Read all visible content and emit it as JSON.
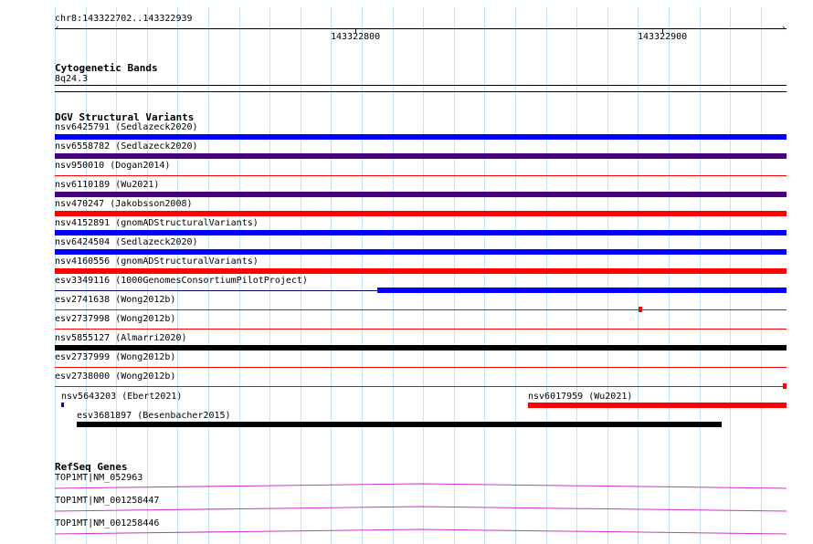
{
  "ruler": {
    "location": "chr8:143322702..143322939",
    "ticks": [
      "143322800",
      "143322900"
    ]
  },
  "cytoband": {
    "title": "Cytogenetic Bands",
    "band": "8q24.3"
  },
  "dgv": {
    "title": "DGV Structural Variants",
    "rows": [
      {
        "label": "nsv6425791 (Sedlazeck2020)",
        "color": "#0000ff",
        "type": "bar"
      },
      {
        "label": "nsv6558782 (Sedlazeck2020)",
        "color": "#4b0082",
        "type": "bar"
      },
      {
        "label": "nsv950010 (Dogan2014)",
        "color": "#ff0000",
        "type": "line"
      },
      {
        "label": "nsv6110189 (Wu2021)",
        "color": "#4b0082",
        "type": "bar"
      },
      {
        "label": "nsv470247 (Jakobsson2008)",
        "color": "#ff0000",
        "type": "bar"
      },
      {
        "label": "nsv4152891 (gnomADStructuralVariants)",
        "color": "#0000ff",
        "type": "bar"
      },
      {
        "label": "nsv6424504 (Sedlazeck2020)",
        "color": "#0000ff",
        "type": "bar"
      },
      {
        "label": "nsv4160556 (gnomADStructuralVariants)",
        "color": "#ff0000",
        "type": "bar"
      },
      {
        "label": "esv3349116 (1000GenomesConsortiumPilotProject)",
        "color": "#0000ff",
        "type": "split"
      },
      {
        "label": "esv2741638 (Wong2012b)",
        "color": "#ff0000",
        "type": "line-end"
      },
      {
        "label": "esv2737998 (Wong2012b)",
        "color": "#ff0000",
        "type": "line"
      },
      {
        "label": "nsv5855127 (Almarri2020)",
        "color": "#000000",
        "type": "bar"
      },
      {
        "label": "esv2737999 (Wong2012b)",
        "color": "#ff0000",
        "type": "line"
      },
      {
        "label": "esv2738000 (Wong2012b)",
        "color": "#ff0000",
        "type": "line-end"
      }
    ],
    "extra": {
      "a": "nsv5643203 (Ebert2021)",
      "b": "nsv6017959 (Wu2021)",
      "c": "esv3681897 (Besenbacher2015)"
    }
  },
  "refseq": {
    "title": "RefSeq Genes",
    "genes": [
      "TOP1MT|NM_052963",
      "TOP1MT|NM_001258447",
      "TOP1MT|NM_001258446"
    ],
    "color": "#cc33cc"
  }
}
